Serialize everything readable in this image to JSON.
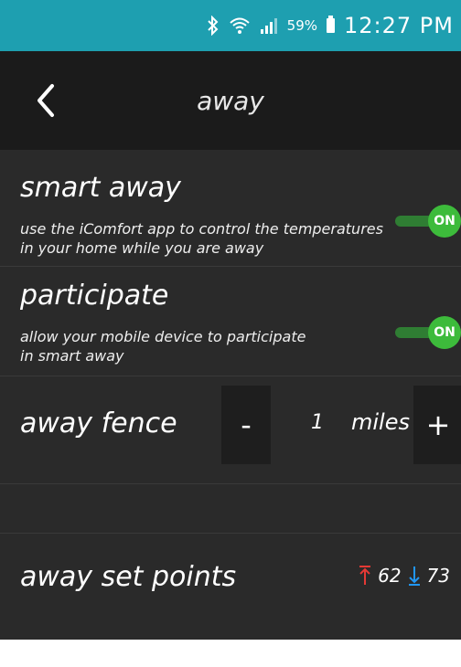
{
  "status_bar": {
    "battery_percent": "59%",
    "time": "12:27 PM",
    "icons": [
      "bluetooth-icon",
      "wifi-icon",
      "signal-icon",
      "battery-icon"
    ]
  },
  "app_bar": {
    "title": "away",
    "back_icon": "chevron-left-icon"
  },
  "settings": {
    "smart_away": {
      "title": "smart away",
      "description": "use the iComfort app to control the temperatures in your home while you are away",
      "toggle_label": "ON"
    },
    "participate": {
      "title": "participate",
      "description": "allow your mobile device to participate in smart away",
      "toggle_label": "ON"
    },
    "away_fence": {
      "title": "away fence",
      "minus_label": "-",
      "value": "1",
      "unit": "miles",
      "plus_label": "+"
    },
    "away_set_points": {
      "title": "away set points",
      "high": "62",
      "low": "73"
    }
  },
  "colors": {
    "status_bar": "#1e9fb0",
    "app_bar": "#1b1b1b",
    "content_bg": "#2a2a2a",
    "toggle_on": "#3dbb3b",
    "up_arrow": "#e53935",
    "down_arrow": "#2196f3"
  }
}
